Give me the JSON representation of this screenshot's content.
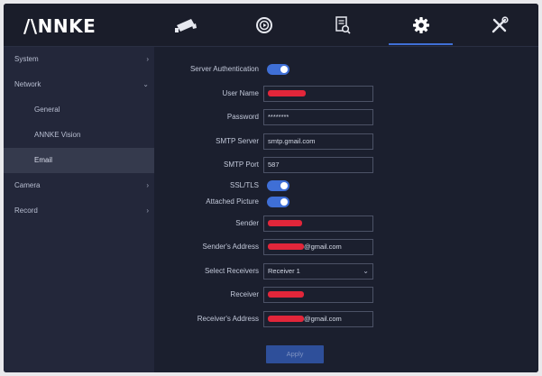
{
  "app": {
    "logo": "/\\NNKE"
  },
  "topnav": {
    "items": [
      {
        "name": "camera",
        "icon": "camera-icon"
      },
      {
        "name": "playback",
        "icon": "playback-icon"
      },
      {
        "name": "search",
        "icon": "file-search-icon"
      },
      {
        "name": "settings",
        "icon": "gear-icon",
        "active": true
      },
      {
        "name": "maintenance",
        "icon": "tools-icon"
      }
    ]
  },
  "sidebar": {
    "items": [
      {
        "label": "System",
        "chevron": "›"
      },
      {
        "label": "Network",
        "chevron": "⌄"
      },
      {
        "label": "General"
      },
      {
        "label": "ANNKE Vision"
      },
      {
        "label": "Email",
        "active": true
      },
      {
        "label": "Camera",
        "chevron": "›"
      },
      {
        "label": "Record",
        "chevron": "›"
      }
    ]
  },
  "form": {
    "server_auth": {
      "label": "Server Authentication",
      "enabled": true
    },
    "user_name": {
      "label": "User Name",
      "value": ""
    },
    "password": {
      "label": "Password",
      "value": "********"
    },
    "smtp_server": {
      "label": "SMTP Server",
      "value": "smtp.gmail.com"
    },
    "smtp_port": {
      "label": "SMTP Port",
      "value": "587"
    },
    "ssl_tls": {
      "label": "SSL/TLS",
      "enabled": true
    },
    "attached_picture": {
      "label": "Attached Picture",
      "enabled": true
    },
    "sender": {
      "label": "Sender",
      "value": ""
    },
    "sender_address": {
      "label": "Sender's Address",
      "suffix": "@gmail.com"
    },
    "select_receivers": {
      "label": "Select Receivers",
      "value": "Receiver 1",
      "chevron": "⌄"
    },
    "receiver": {
      "label": "Receiver",
      "value": ""
    },
    "receiver_address": {
      "label": "Receiver's Address",
      "suffix": "@gmail.com"
    },
    "apply_label": "Apply"
  },
  "colors": {
    "accent": "#3f6fd6",
    "redaction": "#e2263a",
    "background": "#1b1f2e",
    "sidebar": "#23273a"
  }
}
